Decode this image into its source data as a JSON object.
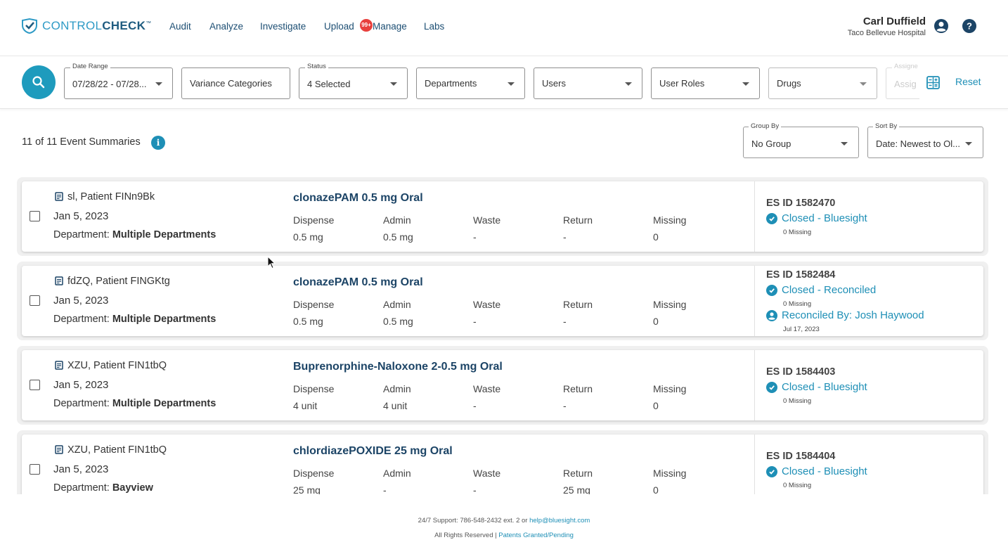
{
  "nav": {
    "logo_part1": "CONTROL",
    "logo_part2": "CHECK",
    "logo_tm": "™",
    "links": [
      "Audit",
      "Analyze",
      "Investigate",
      "Upload",
      "Manage",
      "Labs"
    ],
    "badge": "99+",
    "user_name": "Carl Duffield",
    "user_org": "Taco Bellevue Hospital"
  },
  "filters": {
    "date_range": {
      "label": "Date Range",
      "value": "07/28/22 - 07/28..."
    },
    "variance": {
      "value": "Variance Categories"
    },
    "status": {
      "label": "Status",
      "value": "4 Selected"
    },
    "departments": {
      "value": "Departments"
    },
    "users": {
      "value": "Users"
    },
    "user_roles": {
      "value": "User Roles"
    },
    "drugs": {
      "value": "Drugs"
    },
    "assignee": {
      "label": "Assigne",
      "value": "Assig"
    },
    "reset": "Reset"
  },
  "summary": {
    "count": "11 of 11 Event Summaries",
    "group_by": {
      "label": "Group By",
      "value": "No Group"
    },
    "sort_by": {
      "label": "Sort By",
      "value": "Date: Newest to Ol..."
    }
  },
  "columns": [
    "Dispense",
    "Admin",
    "Waste",
    "Return",
    "Missing"
  ],
  "events": [
    {
      "patient": "sl, Patient FINn9Bk",
      "date": "Jan 5, 2023",
      "dept_label": "Department:",
      "dept": "Multiple Departments",
      "drug": "clonazePAM 0.5 mg Oral",
      "values": [
        "0.5 mg",
        "0.5 mg",
        "-",
        "-",
        "0"
      ],
      "es_id": "ES ID 1582470",
      "status": "Closed - Bluesight",
      "missing": "0 Missing"
    },
    {
      "patient": "fdZQ, Patient FINGKtg",
      "date": "Jan 5, 2023",
      "dept_label": "Department:",
      "dept": "Multiple Departments",
      "drug": "clonazePAM 0.5 mg Oral",
      "values": [
        "0.5 mg",
        "0.5 mg",
        "-",
        "-",
        "0"
      ],
      "es_id": "ES ID 1582484",
      "status": "Closed - Reconciled",
      "missing": "0 Missing",
      "reconciled_by": "Reconciled By: Josh Haywood",
      "reconciled_date": "Jul 17, 2023"
    },
    {
      "patient": "XZU, Patient FIN1tbQ",
      "date": "Jan 5, 2023",
      "dept_label": "Department:",
      "dept": "Multiple Departments",
      "drug": "Buprenorphine-Naloxone 2-0.5 mg Oral",
      "values": [
        "4 unit",
        "4 unit",
        "-",
        "-",
        "0"
      ],
      "es_id": "ES ID 1584403",
      "status": "Closed - Bluesight",
      "missing": "0 Missing"
    },
    {
      "patient": "XZU, Patient FIN1tbQ",
      "date": "Jan 5, 2023",
      "dept_label": "Department:",
      "dept": "Bayview",
      "drug": "chlordiazePOXIDE 25 mg Oral",
      "values": [
        "25 mg",
        "-",
        "-",
        "25 mg",
        "0"
      ],
      "es_id": "ES ID 1584404",
      "status": "Closed - Bluesight",
      "missing": "0 Missing"
    }
  ],
  "footer": {
    "support": "24/7 Support: 786-548-2432 ext. 2 or ",
    "email": "help@bluesight.com",
    "rights": "All Rights Reserved | ",
    "patents": "Patents Granted/Pending"
  },
  "colors": {
    "accent": "#1e9bbd",
    "navy": "#1c4466",
    "badge": "#e8403d"
  }
}
